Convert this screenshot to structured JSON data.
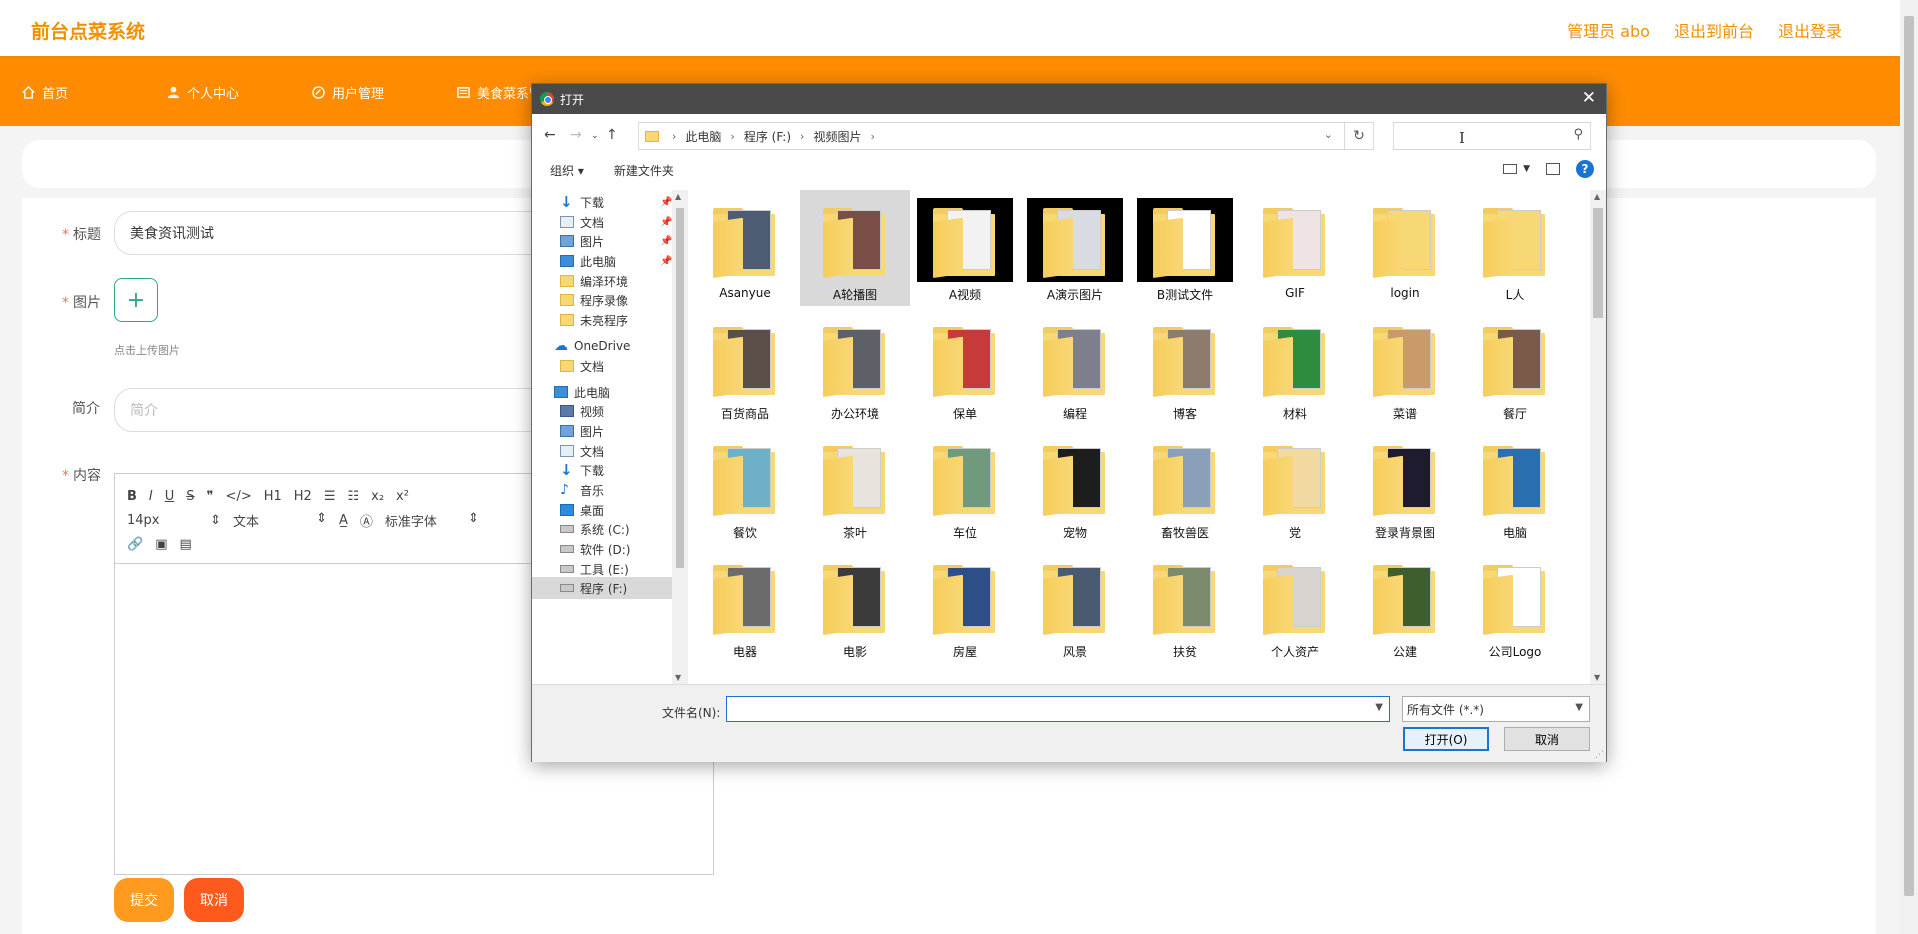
{
  "app": {
    "brand": "前台点菜系统",
    "top_links": [
      "管理员 abo",
      "退出到前台",
      "退出登录"
    ],
    "nav": [
      "首页",
      "个人中心",
      "用户管理",
      "美食菜系管理"
    ]
  },
  "form": {
    "title_label": "标题",
    "title_value": "美食资讯测试",
    "image_label": "图片",
    "upload_plus": "+",
    "upload_tip": "点击上传图片",
    "intro_label": "简介",
    "intro_placeholder": "简介",
    "content_label": "内容",
    "editor": {
      "row1": [
        "B",
        "I",
        "U",
        "S",
        "❞",
        "</>",
        "H1",
        "H2",
        "☰",
        "☷",
        "x₂",
        "x²"
      ],
      "size": "14px",
      "style": "文本",
      "font": "标准字体",
      "row3": [
        "🔗",
        "▣",
        "▤"
      ]
    },
    "submit_label": "提交",
    "cancel_label": "取消"
  },
  "dialog": {
    "title": "打开",
    "close": "✕",
    "breadcrumb": [
      "此电脑",
      "程序 (F:)",
      "视频图片"
    ],
    "organize": "组织 ▾",
    "new_folder": "新建文件夹",
    "help": "?",
    "tree": [
      {
        "label": "下载",
        "icon": "download-icon",
        "pinned": true
      },
      {
        "label": "文档",
        "icon": "document-icon",
        "pinned": true
      },
      {
        "label": "图片",
        "icon": "picture-icon",
        "pinned": true
      },
      {
        "label": "此电脑",
        "icon": "computer-icon",
        "pinned": true
      },
      {
        "label": "编泽环境",
        "icon": "folder-icon",
        "pinned": false
      },
      {
        "label": "程序录像",
        "icon": "folder-icon",
        "pinned": false
      },
      {
        "label": "未亮程序",
        "icon": "folder-icon",
        "pinned": false
      },
      {
        "label": "OneDrive",
        "icon": "cloud-icon",
        "pinned": false
      },
      {
        "label": "文档",
        "icon": "folder-icon",
        "pinned": false
      },
      {
        "label": "此电脑",
        "icon": "computer-icon",
        "pinned": false
      },
      {
        "label": "视频",
        "icon": "video-icon",
        "pinned": false
      },
      {
        "label": "图片",
        "icon": "picture-icon",
        "pinned": false
      },
      {
        "label": "文档",
        "icon": "document-icon",
        "pinned": false
      },
      {
        "label": "下载",
        "icon": "download-icon",
        "pinned": false
      },
      {
        "label": "音乐",
        "icon": "music-icon",
        "pinned": false
      },
      {
        "label": "桌面",
        "icon": "desktop-icon",
        "pinned": false
      },
      {
        "label": "系统 (C:)",
        "icon": "drive-icon",
        "pinned": false
      },
      {
        "label": "软件 (D:)",
        "icon": "drive-icon",
        "pinned": false
      },
      {
        "label": "工具 (E:)",
        "icon": "drive-icon",
        "pinned": false
      },
      {
        "label": "程序 (F:)",
        "icon": "drive-icon",
        "pinned": false,
        "selected": true
      }
    ],
    "folders": [
      {
        "name": "Asanyue",
        "paper": "#4d5b73"
      },
      {
        "name": "A轮播图",
        "paper": "#7a4e46",
        "selected": true
      },
      {
        "name": "A视频",
        "paper": "#f2f2f2",
        "black": true
      },
      {
        "name": "A演示图片",
        "paper": "#d8dbe2",
        "black": true
      },
      {
        "name": "B测试文件",
        "paper": "#ffffff",
        "black": true
      },
      {
        "name": "GIF",
        "paper": "#efe3e3"
      },
      {
        "name": "login",
        "paper": "#f8d775"
      },
      {
        "name": "L人",
        "paper": "#f8d775"
      },
      {
        "name": "百货商品",
        "paper": "#5c4f49"
      },
      {
        "name": "办公环境",
        "paper": "#5d6066"
      },
      {
        "name": "保单",
        "paper": "#c63a3a"
      },
      {
        "name": "编程",
        "paper": "#7e7f8c"
      },
      {
        "name": "博客",
        "paper": "#8d7b6e"
      },
      {
        "name": "材料",
        "paper": "#2e8c3e"
      },
      {
        "name": "菜谱",
        "paper": "#c89a6c"
      },
      {
        "name": "餐厅",
        "paper": "#7b5a4a"
      },
      {
        "name": "餐饮",
        "paper": "#6fb0c9"
      },
      {
        "name": "茶叶",
        "paper": "#e8e3dc"
      },
      {
        "name": "车位",
        "paper": "#6f9a7e"
      },
      {
        "name": "宠物",
        "paper": "#1d1d1d"
      },
      {
        "name": "畜牧兽医",
        "paper": "#8aa0b8"
      },
      {
        "name": "党",
        "paper": "#f1d9a2"
      },
      {
        "name": "登录背景图",
        "paper": "#1f1b2e"
      },
      {
        "name": "电脑",
        "paper": "#2a6fb0"
      },
      {
        "name": "电器",
        "paper": "#6b6b6b"
      },
      {
        "name": "电影",
        "paper": "#3b3b3b"
      },
      {
        "name": "房屋",
        "paper": "#2d4e86"
      },
      {
        "name": "风景",
        "paper": "#4a5a70"
      },
      {
        "name": "扶贫",
        "paper": "#7a8a6a"
      },
      {
        "name": "个人资产",
        "paper": "#d9d4cf"
      },
      {
        "name": "公建",
        "paper": "#3e5e2e"
      },
      {
        "name": "公司Logo",
        "paper": "#ffffff"
      }
    ],
    "filename_label": "文件名(N):",
    "filename_value": "",
    "filetype": "所有文件 (*.*)",
    "open_label": "打开(O)",
    "cancel_label": "取消"
  }
}
